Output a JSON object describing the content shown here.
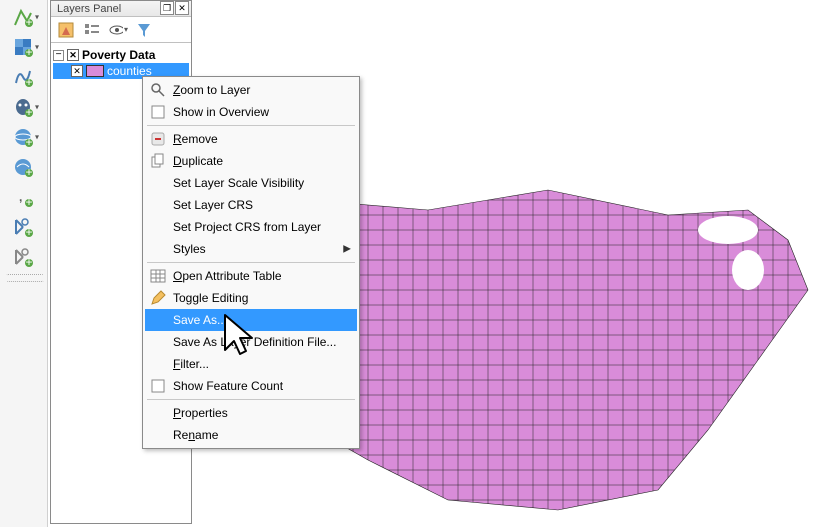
{
  "panel": {
    "title": "Layers Panel",
    "group_label": "Poverty Data",
    "layer_label": "counties"
  },
  "context_menu": {
    "items": [
      {
        "label": "Zoom to Layer",
        "mnemonic": "Z",
        "icon": "zoom-layer-icon"
      },
      {
        "label": "Show in Overview",
        "mnemonic": null,
        "icon": "checkbox-empty-icon"
      },
      {
        "sep": true
      },
      {
        "label": "Remove",
        "mnemonic": "R",
        "icon": "remove-icon"
      },
      {
        "label": "Duplicate",
        "mnemonic": "D",
        "icon": "duplicate-icon"
      },
      {
        "label": "Set Layer Scale Visibility",
        "mnemonic": null,
        "icon": null
      },
      {
        "label": "Set Layer CRS",
        "mnemonic": null,
        "icon": null
      },
      {
        "label": "Set Project CRS from Layer",
        "mnemonic": null,
        "icon": null
      },
      {
        "label": "Styles",
        "mnemonic": null,
        "icon": null,
        "submenu": true
      },
      {
        "sep": true
      },
      {
        "label": "Open Attribute Table",
        "mnemonic": "O",
        "icon": "table-icon"
      },
      {
        "label": "Toggle Editing",
        "mnemonic": null,
        "icon": "pencil-icon"
      },
      {
        "label": "Save As...",
        "mnemonic": null,
        "icon": null,
        "highlight": true
      },
      {
        "label": "Save As Layer Definition File...",
        "mnemonic": null,
        "icon": null
      },
      {
        "label": "Filter...",
        "mnemonic": "F",
        "icon": null
      },
      {
        "label": "Show Feature Count",
        "mnemonic": null,
        "icon": "checkbox-empty-icon"
      },
      {
        "sep": true
      },
      {
        "label": "Properties",
        "mnemonic": "P",
        "icon": null
      },
      {
        "label": "Rename",
        "mnemonic": "n",
        "icon": null
      }
    ]
  },
  "colors": {
    "highlight": "#3399ff",
    "map_fill": "#d98cd9"
  }
}
